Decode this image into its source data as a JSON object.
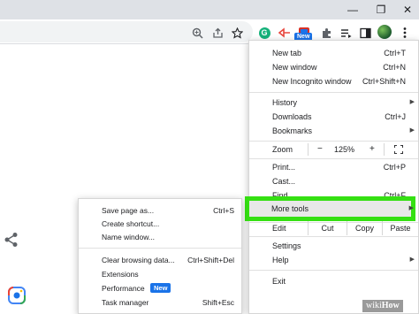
{
  "window_controls": {
    "minimize": "—",
    "maximize": "❐",
    "close": "✕"
  },
  "toolbar": {
    "icons": [
      "zoom-icon",
      "share-icon",
      "star-icon",
      "grammarly-extension-icon",
      "red-extension-icon",
      "new-extension-icon",
      "puzzle-extensions-icon",
      "reading-list-icon",
      "side-panel-icon",
      "avatar",
      "kebab-menu-icon"
    ],
    "new_badge": "New"
  },
  "main_menu": {
    "new_tab": {
      "label": "New tab",
      "shortcut": "Ctrl+T"
    },
    "new_window": {
      "label": "New window",
      "shortcut": "Ctrl+N"
    },
    "new_incognito": {
      "label": "New Incognito window",
      "shortcut": "Ctrl+Shift+N"
    },
    "history": {
      "label": "History"
    },
    "downloads": {
      "label": "Downloads",
      "shortcut": "Ctrl+J"
    },
    "bookmarks": {
      "label": "Bookmarks"
    },
    "zoom": {
      "label": "Zoom",
      "minus": "−",
      "value": "125%",
      "plus": "+"
    },
    "print": {
      "label": "Print...",
      "shortcut": "Ctrl+P"
    },
    "cast": {
      "label": "Cast..."
    },
    "find": {
      "label": "Find...",
      "shortcut": "Ctrl+F"
    },
    "more_tools": {
      "label": "More tools"
    },
    "edit": {
      "label": "Edit",
      "cut": "Cut",
      "copy": "Copy",
      "paste": "Paste"
    },
    "settings": {
      "label": "Settings"
    },
    "help": {
      "label": "Help"
    },
    "exit": {
      "label": "Exit"
    }
  },
  "sub_menu": {
    "save_page": {
      "label": "Save page as...",
      "shortcut": "Ctrl+S"
    },
    "create_shortcut": {
      "label": "Create shortcut..."
    },
    "name_window": {
      "label": "Name window..."
    },
    "clear_data": {
      "label": "Clear browsing data...",
      "shortcut": "Ctrl+Shift+Del"
    },
    "extensions": {
      "label": "Extensions"
    },
    "performance": {
      "label": "Performance",
      "badge": "New"
    },
    "task_manager": {
      "label": "Task manager",
      "shortcut": "Shift+Esc"
    }
  },
  "colors": {
    "highlight": "#35e012",
    "accent": "#1a73e8"
  },
  "watermark": {
    "prefix": "wiki",
    "brand": "How"
  }
}
